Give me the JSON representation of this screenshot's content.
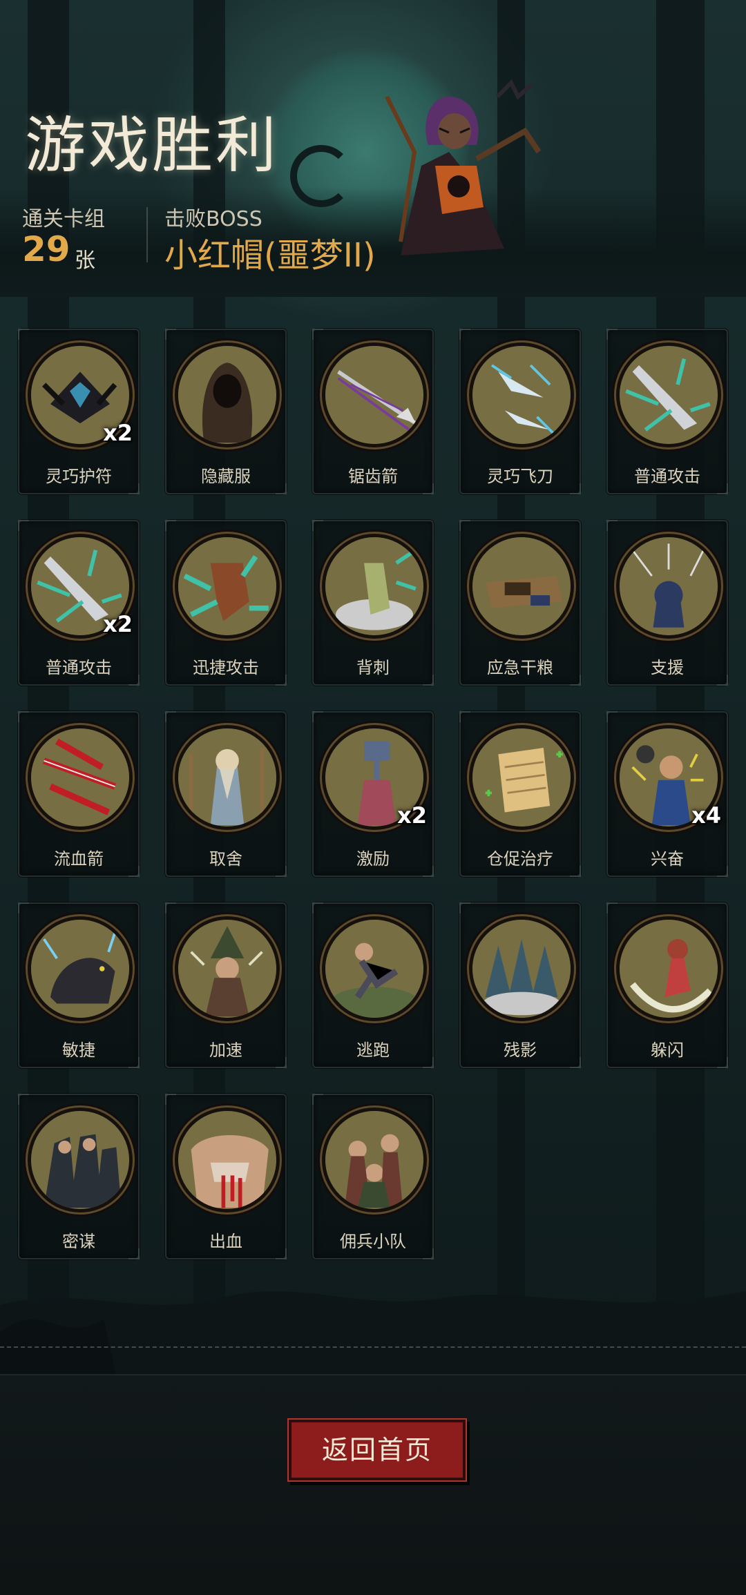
{
  "header": {
    "title": "游戏胜利",
    "deck_label": "通关卡组",
    "deck_count": "29",
    "deck_unit": "张",
    "boss_label": "击败BOSS",
    "boss_name": "小红帽(噩梦II)"
  },
  "cards": [
    {
      "label": "灵巧护符",
      "multiplier": "x2",
      "icon": "amulet-icon",
      "color": "#3a8fb0"
    },
    {
      "label": "隐藏服",
      "multiplier": "",
      "icon": "hood-cloak-icon",
      "color": "#3a2c20"
    },
    {
      "label": "锯齿箭",
      "multiplier": "",
      "icon": "serrated-arrow-icon",
      "color": "#7a3c9c"
    },
    {
      "label": "灵巧飞刀",
      "multiplier": "",
      "icon": "flying-knife-icon",
      "color": "#5cc8e8"
    },
    {
      "label": "普通攻击",
      "multiplier": "",
      "icon": "arrowhead-icon",
      "color": "#3fc2a8"
    },
    {
      "label": "普通攻击",
      "multiplier": "x2",
      "icon": "arrowhead-icon",
      "color": "#3fc2a8"
    },
    {
      "label": "迅捷攻击",
      "multiplier": "",
      "icon": "swift-strike-icon",
      "color": "#3fc2a8"
    },
    {
      "label": "背刺",
      "multiplier": "",
      "icon": "backstab-icon",
      "color": "#3fc2a8"
    },
    {
      "label": "应急干粮",
      "multiplier": "",
      "icon": "rations-icon",
      "color": "#8a6a40"
    },
    {
      "label": "支援",
      "multiplier": "",
      "icon": "support-icon",
      "color": "#2a3a60"
    },
    {
      "label": "流血箭",
      "multiplier": "",
      "icon": "bleeding-arrow-icon",
      "color": "#c01e24"
    },
    {
      "label": "取舍",
      "multiplier": "",
      "icon": "sage-icon",
      "color": "#d8d2c0"
    },
    {
      "label": "激励",
      "multiplier": "x2",
      "icon": "inspire-icon",
      "color": "#a04a5a"
    },
    {
      "label": "仓促治疗",
      "multiplier": "",
      "icon": "scroll-icon",
      "color": "#e0c080"
    },
    {
      "label": "兴奋",
      "multiplier": "x4",
      "icon": "excite-icon",
      "color": "#2a4a8a"
    },
    {
      "label": "敏捷",
      "multiplier": "",
      "icon": "panther-icon",
      "color": "#2a2a30"
    },
    {
      "label": "加速",
      "multiplier": "",
      "icon": "witch-icon",
      "color": "#3c4a30"
    },
    {
      "label": "逃跑",
      "multiplier": "",
      "icon": "runner-icon",
      "color": "#5a6a40"
    },
    {
      "label": "残影",
      "multiplier": "",
      "icon": "afterimage-icon",
      "color": "#3a5a6a"
    },
    {
      "label": "躲闪",
      "multiplier": "",
      "icon": "dodge-icon",
      "color": "#c04040"
    },
    {
      "label": "密谋",
      "multiplier": "",
      "icon": "conspiracy-icon",
      "color": "#2a3038"
    },
    {
      "label": "出血",
      "multiplier": "",
      "icon": "bleed-icon",
      "color": "#c01e24"
    },
    {
      "label": "佣兵小队",
      "multiplier": "",
      "icon": "mercenary-icon",
      "color": "#6a3a30"
    }
  ],
  "footer": {
    "home_button": "返回首页"
  },
  "colors": {
    "accent_gold": "#e2a94a",
    "button_red": "#8c1d1c",
    "medal_bg": "#786e44"
  }
}
